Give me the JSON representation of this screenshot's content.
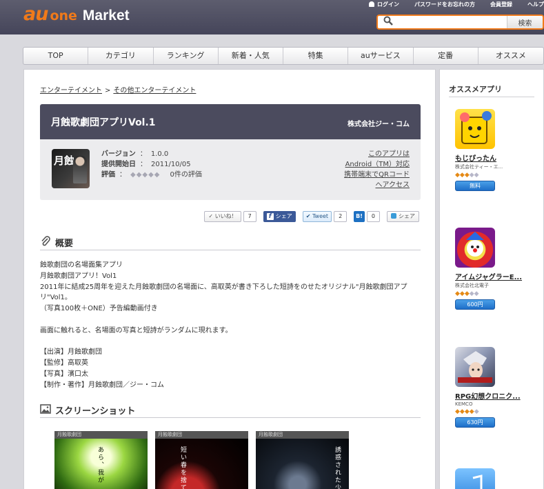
{
  "header": {
    "logo_au": "au",
    "logo_one": "one",
    "logo_market": "Market",
    "links": [
      "ログイン",
      "パスワードをお忘れの方",
      "会員登録",
      "ヘルプ"
    ],
    "search_placeholder": "",
    "search_button": "検索"
  },
  "nav": [
    "TOP",
    "カテゴリ",
    "ランキング",
    "新着・人気",
    "特集",
    "auサービス",
    "定番",
    "オススメ"
  ],
  "breadcrumb": {
    "parent": "エンターテイメント",
    "separator": ">",
    "current": "その他エンターテイメント"
  },
  "app": {
    "title": "月蝕歌劇団アプリVol.1",
    "publisher": "株式会社ジー・コム",
    "icon_text": "月蝕",
    "version_label": "バージョン",
    "version": "1.0.0",
    "start_label": "提供開始日",
    "start_date": "2011/10/05",
    "rating_label": "評価",
    "rating_stars": "◆◆◆◆◆",
    "rating_count": "0件の評価",
    "colon": "：",
    "qr_link": "このアプリは Android（TM）対応 携帯端末でQRコードへアクセス"
  },
  "social": {
    "like_label": "いいね！",
    "like_count": "7",
    "fb_label": "シェア",
    "tweet_label": "Tweet",
    "tweet_count": "2",
    "hatena_label": "B!",
    "hatena_count": "0",
    "share_label": "シェア"
  },
  "overview": {
    "title": "概要",
    "lines": [
      "蝕歌劇団の名場面集アプリ",
      "月蝕歌劇団アプリ！Vol1",
      "2011年に結成25周年を迎えた月蝕歌劇団の名場面に、高取英が書き下ろした短詩をのせたオリジナル\"月蝕歌劇団アプリ\"Vol1。",
      "（写真100枚＋ONE）予告編動画付き",
      "",
      "画面に触れると、名場面の写真と短詩がランダムに現れます。",
      "",
      "【出演】月蝕歌劇団",
      "【監修】高取英",
      "【写真】濱口太",
      "【制作・著作】月蝕歌劇団／ジー・コム"
    ]
  },
  "screenshots": {
    "title": "スクリーンショット",
    "items": [
      {
        "bar": "月蝕歌劇団",
        "text": "あら、我が"
      },
      {
        "bar": "月蝕歌劇団",
        "text": "短い春を捨てま"
      },
      {
        "bar": "月蝕歌劇団",
        "text": "誘惑された少"
      }
    ]
  },
  "sidebar": {
    "title": "オススメアプリ",
    "apps": [
      {
        "name": "もじぴったん",
        "maker": "株式会社ティー・エ...",
        "stars_on": "◆◆◆",
        "stars_off": "◆◆",
        "price": "無料"
      },
      {
        "name": "アイムジャグラーE...",
        "maker": "株式会社北電子",
        "stars_on": "◆◆◆",
        "stars_off": "◆◆",
        "price": "600円"
      },
      {
        "name": "RPG幻想クロニク...",
        "maker": "KEMCO",
        "stars_on": "◆◆◆◆",
        "stars_off": "◆",
        "price": "630円"
      }
    ]
  }
}
